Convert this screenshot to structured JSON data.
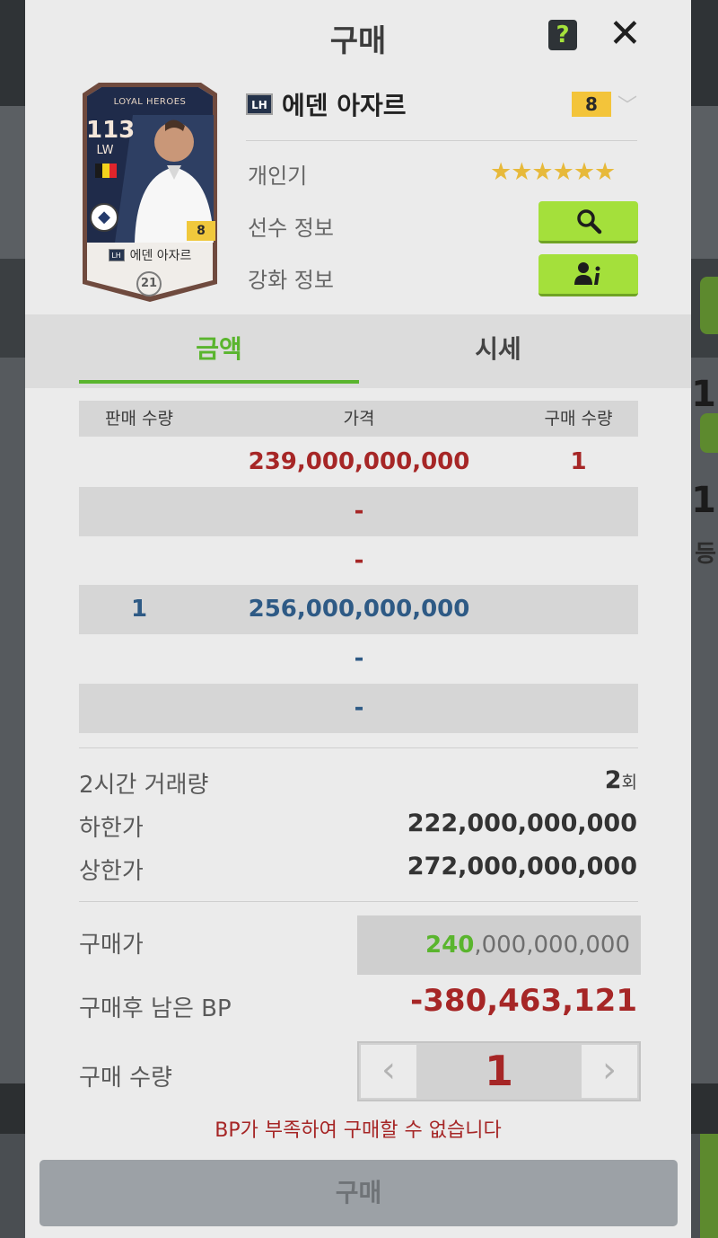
{
  "background": {
    "right_digits": [
      "1",
      "1"
    ],
    "right_text": "등"
  },
  "modal": {
    "title": "구매",
    "help_icon": "question-icon",
    "help_label": "?",
    "close_icon": "close-icon",
    "close_label": "✕"
  },
  "card": {
    "series": "LOYAL HEROES",
    "ovr": "113",
    "position": "LW",
    "level": "8",
    "badge": "LH",
    "name": "에덴 아자르",
    "season": "21",
    "club_icon": "club-crest-icon",
    "club_glyph": "◆"
  },
  "player": {
    "badge": "LH",
    "name": "에덴 아자르",
    "level": "8",
    "level_dropdown_icon": "chevron-down-icon",
    "level_dropdown_glyph": "﹀"
  },
  "info": {
    "popularity_label": "개인기",
    "popularity_stars": 6,
    "stars_text": "★★★★★★",
    "player_info_label": "선수 정보",
    "player_info_icon": "search-icon",
    "enhance_info_label": "강화 정보",
    "enhance_info_icon": "user-info-icon"
  },
  "tabs": [
    {
      "label": "금액",
      "active": true
    },
    {
      "label": "시세",
      "active": false
    }
  ],
  "table": {
    "headers": [
      "판매 수량",
      "가격",
      "구매 수량"
    ],
    "rows": [
      {
        "sell_qty": "",
        "price": "239,000,000,000",
        "buy_qty": "1",
        "color": "#a62626"
      },
      {
        "sell_qty": "",
        "price": "-",
        "buy_qty": "",
        "color": "#a62626"
      },
      {
        "sell_qty": "",
        "price": "-",
        "buy_qty": "",
        "color": "#a62626"
      },
      {
        "sell_qty": "1",
        "price": "256,000,000,000",
        "buy_qty": "",
        "color": "#2e5a85"
      },
      {
        "sell_qty": "",
        "price": "-",
        "buy_qty": "",
        "color": "#2e5a85"
      },
      {
        "sell_qty": "",
        "price": "-",
        "buy_qty": "",
        "color": "#2e5a85"
      }
    ]
  },
  "stats": {
    "volume_label": "2시간 거래량",
    "volume_value": "2",
    "volume_unit": "회",
    "min_label": "하한가",
    "min_value": "222,000,000,000",
    "max_label": "상한가",
    "max_value": "272,000,000,000"
  },
  "purchase": {
    "price_label": "구매가",
    "price_highlight": "240",
    "price_rest": ",000,000,000",
    "remaining_label": "구매후 남은 BP",
    "remaining_value": "-380,463,121",
    "qty_label": "구매 수량",
    "qty_value": "1",
    "qty_prev_icon": "chevron-left-icon",
    "qty_prev_glyph": "‹",
    "qty_next_icon": "chevron-right-icon",
    "qty_next_glyph": "›",
    "warning": "BP가 부족하여 구매할 수 없습니다",
    "buy_button": "구매"
  },
  "colors": {
    "accent_green": "#5ab52e",
    "button_green": "#a4e03b",
    "sell_red": "#a62626",
    "buy_blue": "#2e5a85",
    "level_gold": "#f3c43a"
  }
}
